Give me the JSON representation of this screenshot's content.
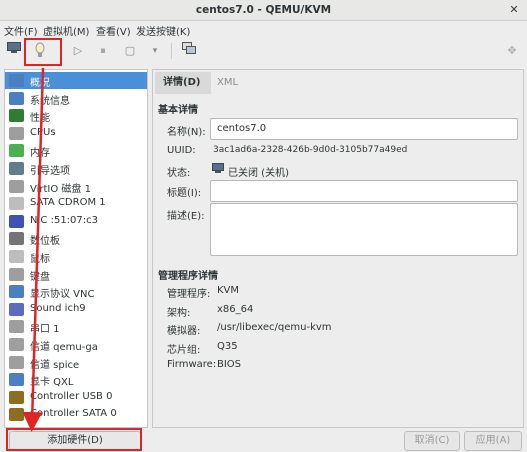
{
  "window": {
    "title": "centos7.0 - QEMU/KVM",
    "close_glyph": "✕"
  },
  "menubar": [
    "文件(F)",
    "虚拟机(M)",
    "查看(V)",
    "发送按键(K)"
  ],
  "toolbar": {
    "icons": [
      "monitor-icon",
      "lightbulb-icon",
      "play-icon",
      "pause-icon",
      "stop-icon",
      "dropdown-icon",
      "screenshot-icon",
      "move-icon"
    ]
  },
  "sidebar": {
    "items": [
      {
        "label": "概况",
        "icon": "overview-icon",
        "color": "#4a7fc1",
        "selected": true
      },
      {
        "label": "系统信息",
        "icon": "sysinfo-icon",
        "color": "#4a7fc1"
      },
      {
        "label": "性能",
        "icon": "performance-icon",
        "color": "#2e7d32"
      },
      {
        "label": "CPUs",
        "icon": "cpu-icon",
        "color": "#9e9e9e"
      },
      {
        "label": "内存",
        "icon": "memory-icon",
        "color": "#4caf50"
      },
      {
        "label": "引导选项",
        "icon": "boot-icon",
        "color": "#607d8b"
      },
      {
        "label": "VirtIO 磁盘 1",
        "icon": "disk-icon",
        "color": "#9e9e9e"
      },
      {
        "label": "SATA CDROM 1",
        "icon": "cdrom-icon",
        "color": "#bdbdbd"
      },
      {
        "label": "NIC :51:07:c3",
        "icon": "nic-icon",
        "color": "#3f51b5"
      },
      {
        "label": "数位板",
        "icon": "tablet-icon",
        "color": "#757575"
      },
      {
        "label": "鼠标",
        "icon": "mouse-icon",
        "color": "#bdbdbd"
      },
      {
        "label": "键盘",
        "icon": "keyboard-icon",
        "color": "#9e9e9e"
      },
      {
        "label": "显示协议 VNC",
        "icon": "display-icon",
        "color": "#4a7fc1"
      },
      {
        "label": "Sound ich9",
        "icon": "sound-icon",
        "color": "#5c6bc0"
      },
      {
        "label": "串口 1",
        "icon": "serial-icon",
        "color": "#9e9e9e"
      },
      {
        "label": "信道 qemu-ga",
        "icon": "channel-icon",
        "color": "#9e9e9e"
      },
      {
        "label": "信道 spice",
        "icon": "channel-icon",
        "color": "#9e9e9e"
      },
      {
        "label": "显卡 QXL",
        "icon": "video-icon",
        "color": "#4a7fc1"
      },
      {
        "label": "Controller USB 0",
        "icon": "controller-icon",
        "color": "#8d6e1f"
      },
      {
        "label": "Controller SATA 0",
        "icon": "controller-icon",
        "color": "#8d6e1f"
      }
    ],
    "add_hardware": "添加硬件(D)"
  },
  "tabs": [
    {
      "label": "详情(D)",
      "active": true
    },
    {
      "label": "XML",
      "active": false
    }
  ],
  "basic": {
    "title": "基本详情",
    "name_label": "名称(N):",
    "name_value": "centos7.0",
    "uuid_label": "UUID:",
    "uuid_value": "3ac1ad6a-2328-426b-9d0d-3105b77a49ed",
    "status_label": "状态:",
    "status_value": "已关闭 (关机)",
    "title_label": "标题(I):",
    "title_value": "",
    "desc_label": "描述(E):",
    "desc_value": ""
  },
  "hypervisor": {
    "title": "管理程序详情",
    "rows": [
      {
        "label": "管理程序:",
        "value": "KVM"
      },
      {
        "label": "架构:",
        "value": "x86_64"
      },
      {
        "label": "模拟器:",
        "value": "/usr/libexec/qemu-kvm"
      },
      {
        "label": "芯片组:",
        "value": "Q35"
      },
      {
        "label": "Firmware:",
        "value": "BIOS"
      }
    ]
  },
  "buttons": {
    "cancel": "取消(C)",
    "apply": "应用(A)"
  },
  "accent": "#4a90d9",
  "annotation_color": "#e02424"
}
